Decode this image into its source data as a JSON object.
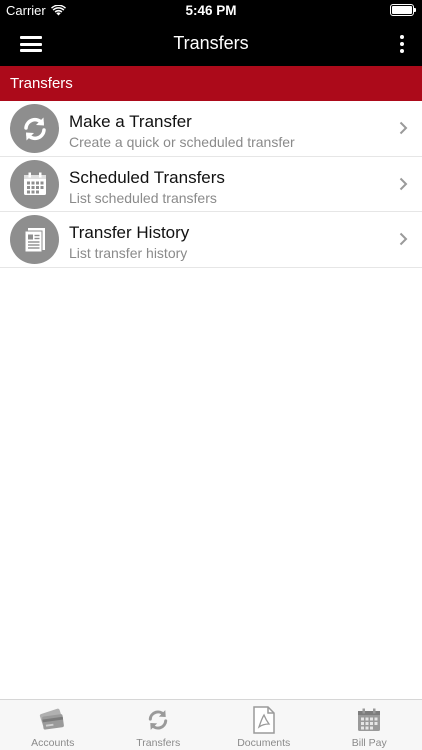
{
  "status_bar": {
    "carrier": "Carrier",
    "time": "5:46 PM"
  },
  "nav": {
    "title": "Transfers"
  },
  "section": {
    "header": "Transfers"
  },
  "items": [
    {
      "title": "Make a Transfer",
      "subtitle": "Create a quick or scheduled transfer",
      "icon": "refresh-icon"
    },
    {
      "title": "Scheduled Transfers",
      "subtitle": "List scheduled transfers",
      "icon": "calendar-icon"
    },
    {
      "title": "Transfer History",
      "subtitle": "List transfer history",
      "icon": "document-icon"
    }
  ],
  "tabs": [
    {
      "label": "Accounts",
      "icon": "cards-icon"
    },
    {
      "label": "Transfers",
      "icon": "refresh-icon"
    },
    {
      "label": "Documents",
      "icon": "pdf-document-icon"
    },
    {
      "label": "Bill Pay",
      "icon": "calendar-icon"
    }
  ],
  "colors": {
    "header_red": "#ac0a1a",
    "icon_gray": "#8e8e8e",
    "bar_black": "#000000"
  }
}
